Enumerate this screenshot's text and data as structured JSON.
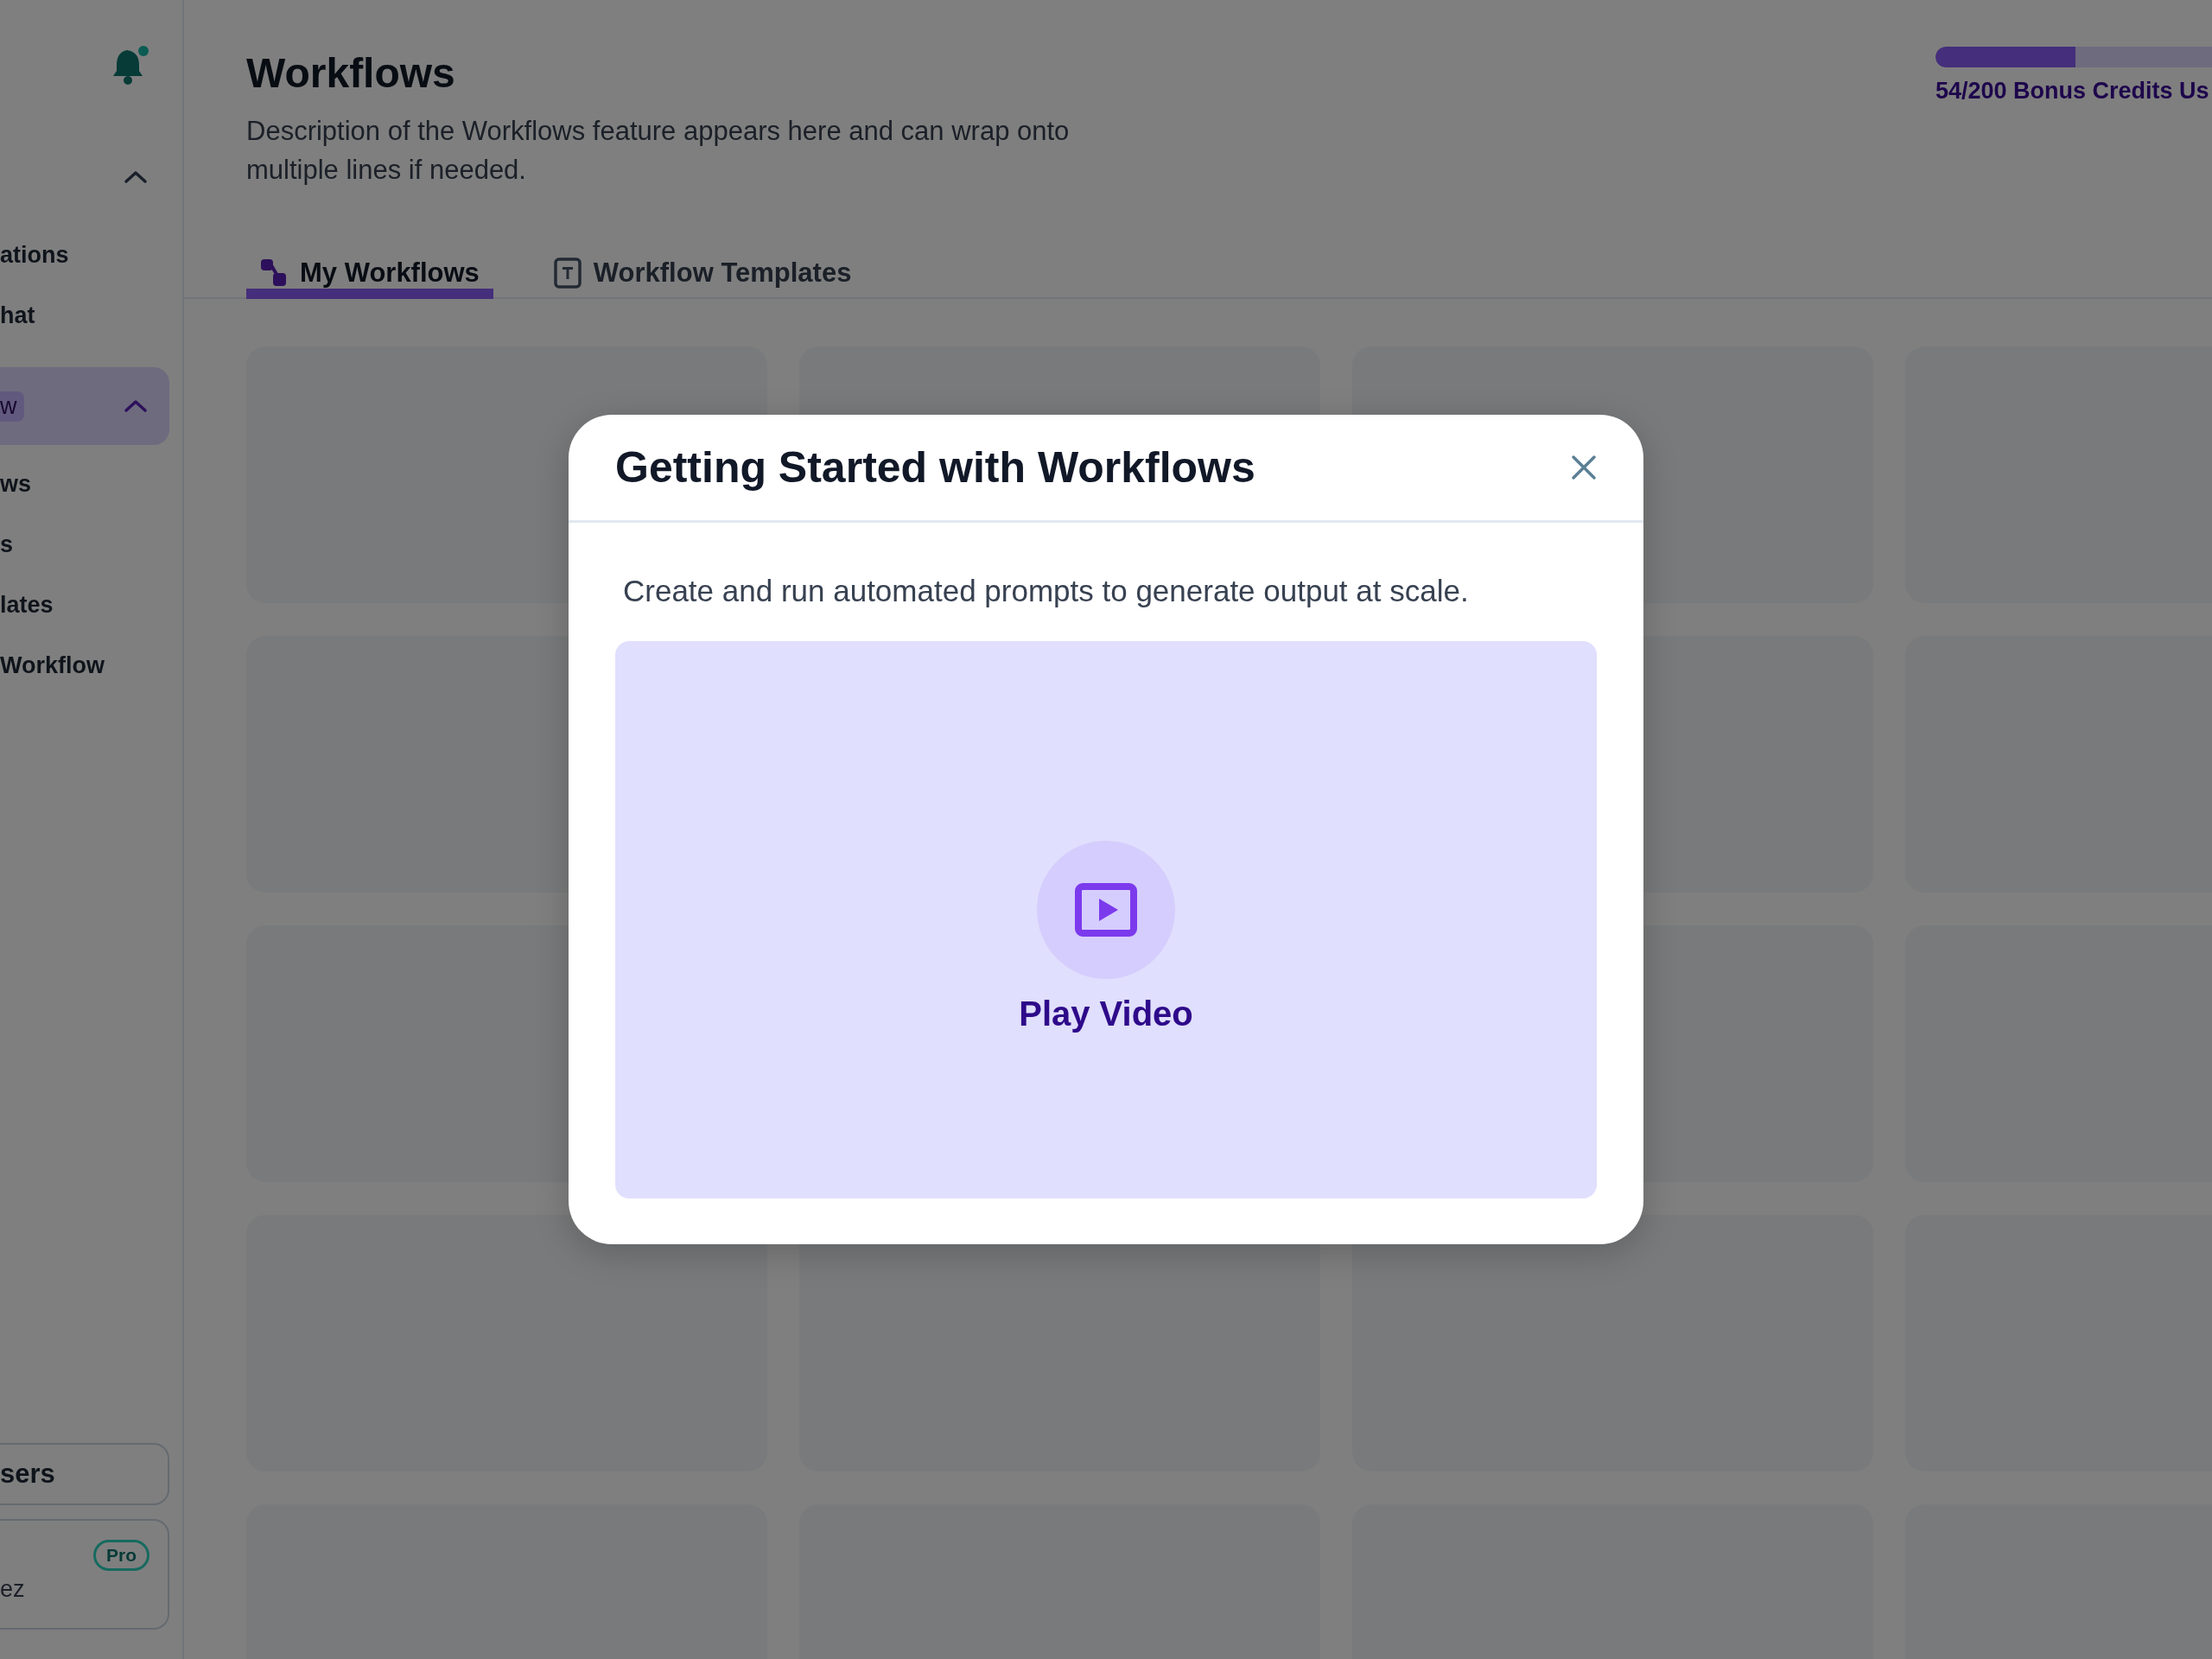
{
  "sidebar": {
    "items": [
      {
        "kind": "toggle",
        "expanded": true
      },
      {
        "kind": "link",
        "label": "ations"
      },
      {
        "kind": "link",
        "label": "hat"
      },
      {
        "kind": "group",
        "label": "w",
        "selected": true,
        "expanded": true
      },
      {
        "kind": "link",
        "label": "ws"
      },
      {
        "kind": "link",
        "label": "s"
      },
      {
        "kind": "link",
        "label": "lates"
      },
      {
        "kind": "link",
        "label": "Workflow"
      }
    ],
    "footer_button": {
      "label": "sers"
    },
    "account": {
      "name": "ez",
      "plan": "Pro"
    }
  },
  "header": {
    "title": "Workflows",
    "description": "Description of the Workflows feature appears here and can wrap onto multiple lines if needed."
  },
  "credits": {
    "level": 0.27,
    "label": "54/200 Bonus Credits Us"
  },
  "tabs": [
    {
      "label": "My Workflows",
      "selected": true
    },
    {
      "label": "Workflow Templates",
      "selected": false
    }
  ],
  "cards": [
    {
      "kind": "skeleton"
    },
    {
      "kind": "skeleton"
    },
    {
      "kind": "skeleton"
    },
    {
      "kind": "skeleton"
    },
    {
      "kind": "skeleton"
    },
    {
      "kind": "covered"
    },
    {
      "kind": "skeleton"
    },
    {
      "kind": "skeleton"
    },
    {
      "kind": "skeleton"
    },
    {
      "kind": "covered"
    },
    {
      "kind": "skeleton"
    },
    {
      "kind": "skeleton"
    },
    {
      "kind": "skeleton"
    },
    {
      "kind": "skeleton"
    },
    {
      "kind": "skeleton"
    },
    {
      "kind": "skeleton"
    },
    {
      "kind": "skeleton"
    },
    {
      "kind": "skeleton"
    },
    {
      "kind": "skeleton"
    },
    {
      "kind": "skeleton"
    }
  ],
  "modal": {
    "title": "Getting Started with Workflows",
    "description": "Create and run automated prompts to generate output at scale.",
    "video": {
      "label": "Play Video"
    }
  }
}
